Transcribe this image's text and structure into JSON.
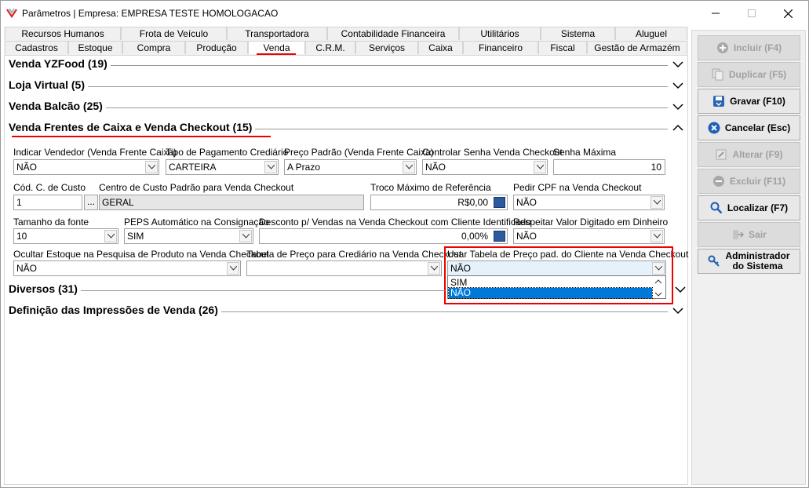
{
  "window": {
    "title": "Parâmetros | Empresa: EMPRESA TESTE HOMOLOGACAO"
  },
  "tabs": {
    "row1": [
      "Recursos Humanos",
      "Frota de Veículo",
      "Transportadora",
      "Contabilidade Financeira",
      "Utilitários",
      "Sistema",
      "Aluguel"
    ],
    "row2": [
      "Cadastros",
      "Estoque",
      "Compra",
      "Produção",
      "Venda",
      "C.R.M.",
      "Serviços",
      "Caixa",
      "Financeiro",
      "Fiscal",
      "Gestão de Armazém"
    ],
    "selected": "Venda"
  },
  "sections": {
    "yzfood": "Venda YZFood (19)",
    "loja": "Loja Virtual (5)",
    "balcao": "Venda Balcão (25)",
    "frentes": "Venda Frentes de Caixa e Venda Checkout (15)",
    "diversos": "Diversos (31)",
    "impressoes": "Definição das Impressões de Venda (26)"
  },
  "fields": {
    "indicar_vendedor": {
      "label": "Indicar Vendedor (Venda Frente Caixa)",
      "value": "NÃO"
    },
    "tipo_pagamento": {
      "label": "Tipo de Pagamento Crediário",
      "value": "CARTEIRA"
    },
    "preco_padrao": {
      "label": "Preço Padrão (Venda Frente Caixa)",
      "value": "A Prazo"
    },
    "controlar_senha": {
      "label": "Controlar Senha Venda Checkout",
      "value": "NÃO"
    },
    "senha_maxima": {
      "label": "Senha Máxima",
      "value": "10"
    },
    "cod_custo": {
      "label": "Cód. C. de Custo",
      "value": "1",
      "button": "..."
    },
    "centro_custo": {
      "label": "Centro de Custo Padrão para Venda Checkout",
      "value": "GERAL"
    },
    "troco_maximo": {
      "label": "Troco Máximo de Referência",
      "value": "R$0,00"
    },
    "pedir_cpf": {
      "label": "Pedir CPF na Venda Checkout",
      "value": "NÃO"
    },
    "tamanho_fonte": {
      "label": "Tamanho da fonte",
      "value": "10"
    },
    "peps": {
      "label": "PEPS Automático na Consignação",
      "value": "SIM"
    },
    "desconto": {
      "label": "Desconto p/ Vendas na Venda Checkout com Cliente Identificado",
      "value": "0,00%"
    },
    "respeitar_valor": {
      "label": "Respeitar Valor Digitado em Dinheiro",
      "value": "NÃO"
    },
    "ocultar_estoque": {
      "label": "Ocultar Estoque na Pesquisa de Produto na Venda Checkout",
      "value": "NÃO"
    },
    "tabela_preco_crediario": {
      "label": "Tabela de Preço para Crediário na Venda Checkout",
      "value": ""
    },
    "usar_tabela_cliente": {
      "label": "Usar Tabela de Preço pad. do Cliente na Venda Checkout",
      "value": "NÃO",
      "options": [
        "SIM",
        "NÃO"
      ],
      "highlighted": "NÃO"
    }
  },
  "buttons": {
    "incluir": "Incluir (F4)",
    "duplicar": "Duplicar (F5)",
    "gravar": "Gravar (F10)",
    "cancelar": "Cancelar (Esc)",
    "alterar": "Alterar (F9)",
    "excluir": "Excluir (F11)",
    "localizar": "Localizar (F7)",
    "sair": "Sair",
    "admin_line1": "Administrador",
    "admin_line2": "do Sistema"
  },
  "colors": {
    "annotation": "#e00000",
    "selection": "#0078d7",
    "calc_icon": "#2b5b9e"
  }
}
